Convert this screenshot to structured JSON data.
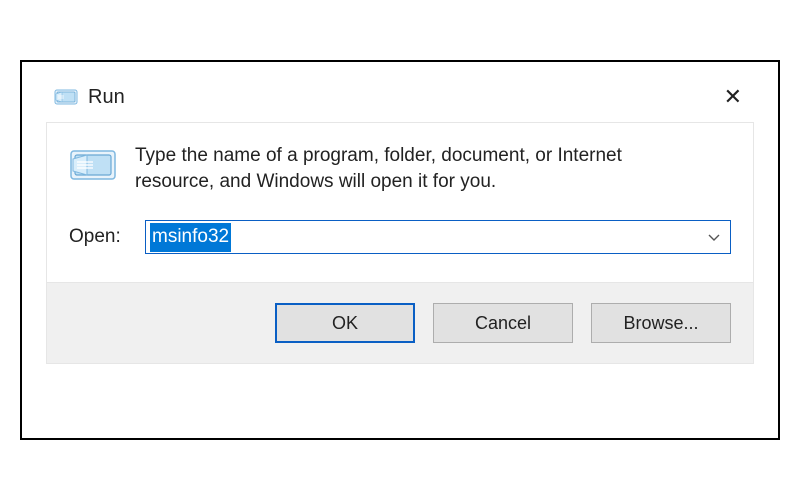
{
  "titlebar": {
    "title": "Run",
    "close_label": "✕"
  },
  "content": {
    "description": "Type the name of a program, folder, document, or Internet resource, and Windows will open it for you.",
    "open_label": "Open:",
    "input_value": "msinfo32"
  },
  "buttons": {
    "ok": "OK",
    "cancel": "Cancel",
    "browse": "Browse..."
  }
}
